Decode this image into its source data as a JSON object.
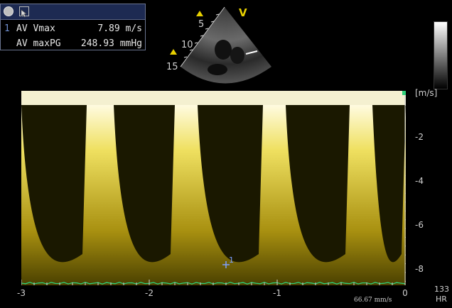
{
  "measurement_panel": {
    "rows": [
      {
        "index": "1",
        "name": "AV Vmax",
        "value": "7.89 m/s"
      },
      {
        "index": "",
        "name": "AV maxPG",
        "value": "248.93 mmHg"
      }
    ]
  },
  "sector": {
    "mode_marker": "V",
    "depth_labels": [
      "5",
      "10",
      "15"
    ]
  },
  "spectrum": {
    "velocity_unit": "[m/s]",
    "velocity_ticks": [
      "-2",
      "-4",
      "-6",
      "-8"
    ],
    "time_ticks": [
      "-3",
      "-2",
      "-1",
      "0"
    ],
    "sweep_speed": "66.67 mm/s",
    "cursor_label": "1"
  },
  "heart_rate": {
    "value": "133",
    "label": "HR"
  },
  "colors": {
    "spectral": "#e8d000",
    "ecg": "#2fd07a",
    "cursor": "#7ea0ff"
  }
}
